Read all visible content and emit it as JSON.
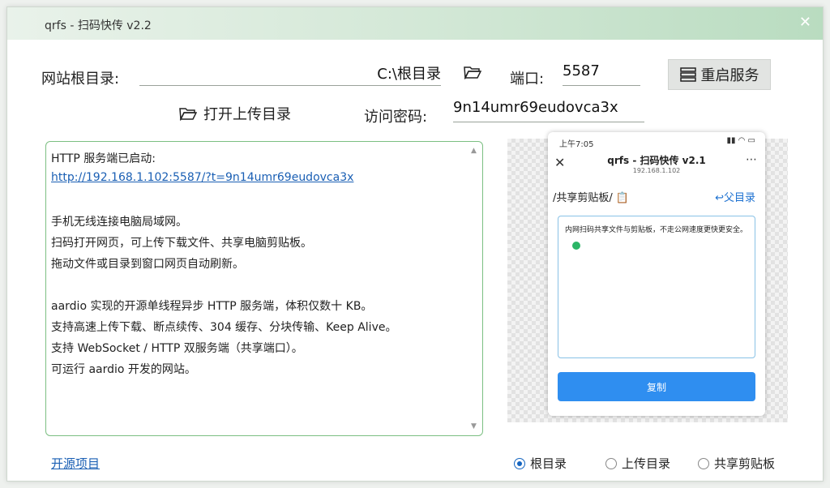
{
  "window": {
    "title": "qrfs - 扫码快传  v2.2"
  },
  "root": {
    "label": "网站根目录:",
    "value": "C:\\根目录"
  },
  "port": {
    "label": "端口:",
    "value": "5587"
  },
  "restart_label": "重启服务",
  "open_upload_label": "打开上传目录",
  "password": {
    "label": "访问密码:",
    "value": "9n14umr69eudovca3x"
  },
  "log": {
    "lines": [
      "HTTP 服务端已启动:",
      "http://192.168.1.102:5587/?t=9n14umr69eudovca3x",
      "",
      "手机无线连接电脑局域网。",
      "扫码打开网页，可上传下载文件、共享电脑剪贴板。",
      "拖动文件或目录到窗口网页自动刷新。",
      "",
      "aardio 实现的开源单线程异步 HTTP 服务端，体积仅数十 KB。",
      "支持高速上传下载、断点续传、304 缓存、分块传输、Keep Alive。",
      "支持 WebSocket / HTTP 双服务端（共享端口）。",
      "可运行 aardio 开发的网站。"
    ]
  },
  "phone": {
    "status_time": "上午7:05",
    "status_right": "▮▮ ◠ ▭",
    "title": "qrfs - 扫码快传 v2.1",
    "subtitle": "192.168.1.102",
    "path": "/共享剪贴板/ 📋",
    "parent": "↩父目录",
    "clipboard_text": "内网扫码共享文件与剪贴板，不走公网速度更快更安全。",
    "copy_label": "复制"
  },
  "footer": {
    "open_source": "开源项目",
    "radios": [
      {
        "label": "根目录",
        "selected": true
      },
      {
        "label": "上传目录",
        "selected": false
      },
      {
        "label": "共享剪贴板",
        "selected": false
      }
    ]
  },
  "colors": {
    "accent": "#1565c0",
    "link": "#1a5fb4",
    "log_border": "#7cbf82",
    "copy_button": "#2f8ef0"
  }
}
